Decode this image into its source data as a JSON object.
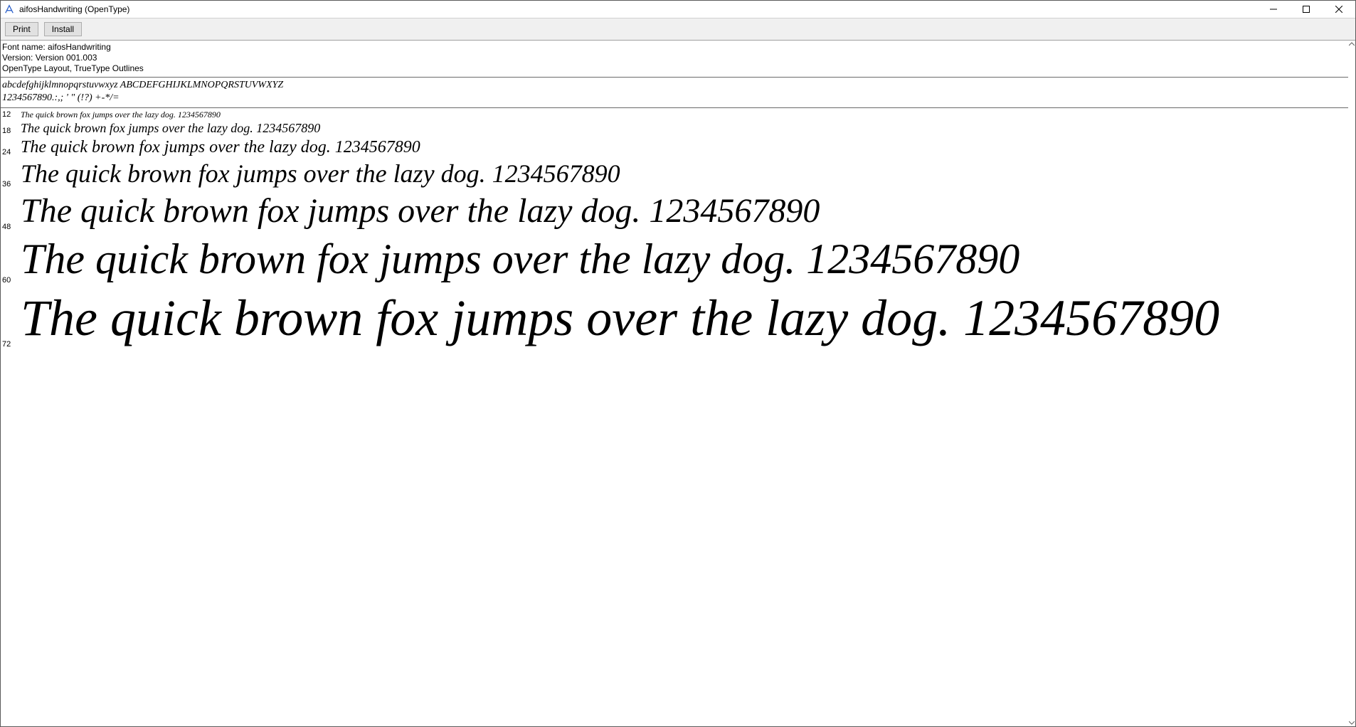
{
  "window": {
    "title": "aifosHandwriting (OpenType)"
  },
  "toolbar": {
    "print_label": "Print",
    "install_label": "Install"
  },
  "info": {
    "font_name_line": "Font name: aifosHandwriting",
    "version_line": "Version: Version 001.003",
    "layout_line": "OpenType Layout, TrueType Outlines"
  },
  "alphabet": {
    "line1": "abcdefghijklmnopqrstuvwxyz ABCDEFGHIJKLMNOPQRSTUVWXYZ",
    "line2": "1234567890.:,; ' \" (!?) +-*/="
  },
  "pangram": "The quick brown fox jumps over the lazy dog. 1234567890",
  "sizes": [
    12,
    18,
    24,
    36,
    48,
    60,
    72
  ]
}
